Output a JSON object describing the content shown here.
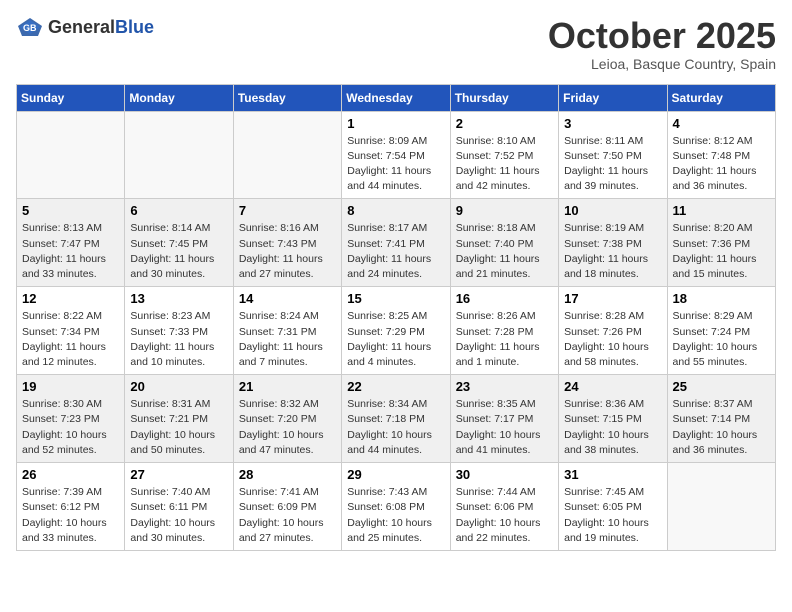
{
  "header": {
    "logo_general": "General",
    "logo_blue": "Blue",
    "month_title": "October 2025",
    "location": "Leioa, Basque Country, Spain"
  },
  "days_of_week": [
    "Sunday",
    "Monday",
    "Tuesday",
    "Wednesday",
    "Thursday",
    "Friday",
    "Saturday"
  ],
  "weeks": [
    [
      {
        "day": "",
        "info": ""
      },
      {
        "day": "",
        "info": ""
      },
      {
        "day": "",
        "info": ""
      },
      {
        "day": "1",
        "info": "Sunrise: 8:09 AM\nSunset: 7:54 PM\nDaylight: 11 hours and 44 minutes."
      },
      {
        "day": "2",
        "info": "Sunrise: 8:10 AM\nSunset: 7:52 PM\nDaylight: 11 hours and 42 minutes."
      },
      {
        "day": "3",
        "info": "Sunrise: 8:11 AM\nSunset: 7:50 PM\nDaylight: 11 hours and 39 minutes."
      },
      {
        "day": "4",
        "info": "Sunrise: 8:12 AM\nSunset: 7:48 PM\nDaylight: 11 hours and 36 minutes."
      }
    ],
    [
      {
        "day": "5",
        "info": "Sunrise: 8:13 AM\nSunset: 7:47 PM\nDaylight: 11 hours and 33 minutes."
      },
      {
        "day": "6",
        "info": "Sunrise: 8:14 AM\nSunset: 7:45 PM\nDaylight: 11 hours and 30 minutes."
      },
      {
        "day": "7",
        "info": "Sunrise: 8:16 AM\nSunset: 7:43 PM\nDaylight: 11 hours and 27 minutes."
      },
      {
        "day": "8",
        "info": "Sunrise: 8:17 AM\nSunset: 7:41 PM\nDaylight: 11 hours and 24 minutes."
      },
      {
        "day": "9",
        "info": "Sunrise: 8:18 AM\nSunset: 7:40 PM\nDaylight: 11 hours and 21 minutes."
      },
      {
        "day": "10",
        "info": "Sunrise: 8:19 AM\nSunset: 7:38 PM\nDaylight: 11 hours and 18 minutes."
      },
      {
        "day": "11",
        "info": "Sunrise: 8:20 AM\nSunset: 7:36 PM\nDaylight: 11 hours and 15 minutes."
      }
    ],
    [
      {
        "day": "12",
        "info": "Sunrise: 8:22 AM\nSunset: 7:34 PM\nDaylight: 11 hours and 12 minutes."
      },
      {
        "day": "13",
        "info": "Sunrise: 8:23 AM\nSunset: 7:33 PM\nDaylight: 11 hours and 10 minutes."
      },
      {
        "day": "14",
        "info": "Sunrise: 8:24 AM\nSunset: 7:31 PM\nDaylight: 11 hours and 7 minutes."
      },
      {
        "day": "15",
        "info": "Sunrise: 8:25 AM\nSunset: 7:29 PM\nDaylight: 11 hours and 4 minutes."
      },
      {
        "day": "16",
        "info": "Sunrise: 8:26 AM\nSunset: 7:28 PM\nDaylight: 11 hours and 1 minute."
      },
      {
        "day": "17",
        "info": "Sunrise: 8:28 AM\nSunset: 7:26 PM\nDaylight: 10 hours and 58 minutes."
      },
      {
        "day": "18",
        "info": "Sunrise: 8:29 AM\nSunset: 7:24 PM\nDaylight: 10 hours and 55 minutes."
      }
    ],
    [
      {
        "day": "19",
        "info": "Sunrise: 8:30 AM\nSunset: 7:23 PM\nDaylight: 10 hours and 52 minutes."
      },
      {
        "day": "20",
        "info": "Sunrise: 8:31 AM\nSunset: 7:21 PM\nDaylight: 10 hours and 50 minutes."
      },
      {
        "day": "21",
        "info": "Sunrise: 8:32 AM\nSunset: 7:20 PM\nDaylight: 10 hours and 47 minutes."
      },
      {
        "day": "22",
        "info": "Sunrise: 8:34 AM\nSunset: 7:18 PM\nDaylight: 10 hours and 44 minutes."
      },
      {
        "day": "23",
        "info": "Sunrise: 8:35 AM\nSunset: 7:17 PM\nDaylight: 10 hours and 41 minutes."
      },
      {
        "day": "24",
        "info": "Sunrise: 8:36 AM\nSunset: 7:15 PM\nDaylight: 10 hours and 38 minutes."
      },
      {
        "day": "25",
        "info": "Sunrise: 8:37 AM\nSunset: 7:14 PM\nDaylight: 10 hours and 36 minutes."
      }
    ],
    [
      {
        "day": "26",
        "info": "Sunrise: 7:39 AM\nSunset: 6:12 PM\nDaylight: 10 hours and 33 minutes."
      },
      {
        "day": "27",
        "info": "Sunrise: 7:40 AM\nSunset: 6:11 PM\nDaylight: 10 hours and 30 minutes."
      },
      {
        "day": "28",
        "info": "Sunrise: 7:41 AM\nSunset: 6:09 PM\nDaylight: 10 hours and 27 minutes."
      },
      {
        "day": "29",
        "info": "Sunrise: 7:43 AM\nSunset: 6:08 PM\nDaylight: 10 hours and 25 minutes."
      },
      {
        "day": "30",
        "info": "Sunrise: 7:44 AM\nSunset: 6:06 PM\nDaylight: 10 hours and 22 minutes."
      },
      {
        "day": "31",
        "info": "Sunrise: 7:45 AM\nSunset: 6:05 PM\nDaylight: 10 hours and 19 minutes."
      },
      {
        "day": "",
        "info": ""
      }
    ]
  ]
}
